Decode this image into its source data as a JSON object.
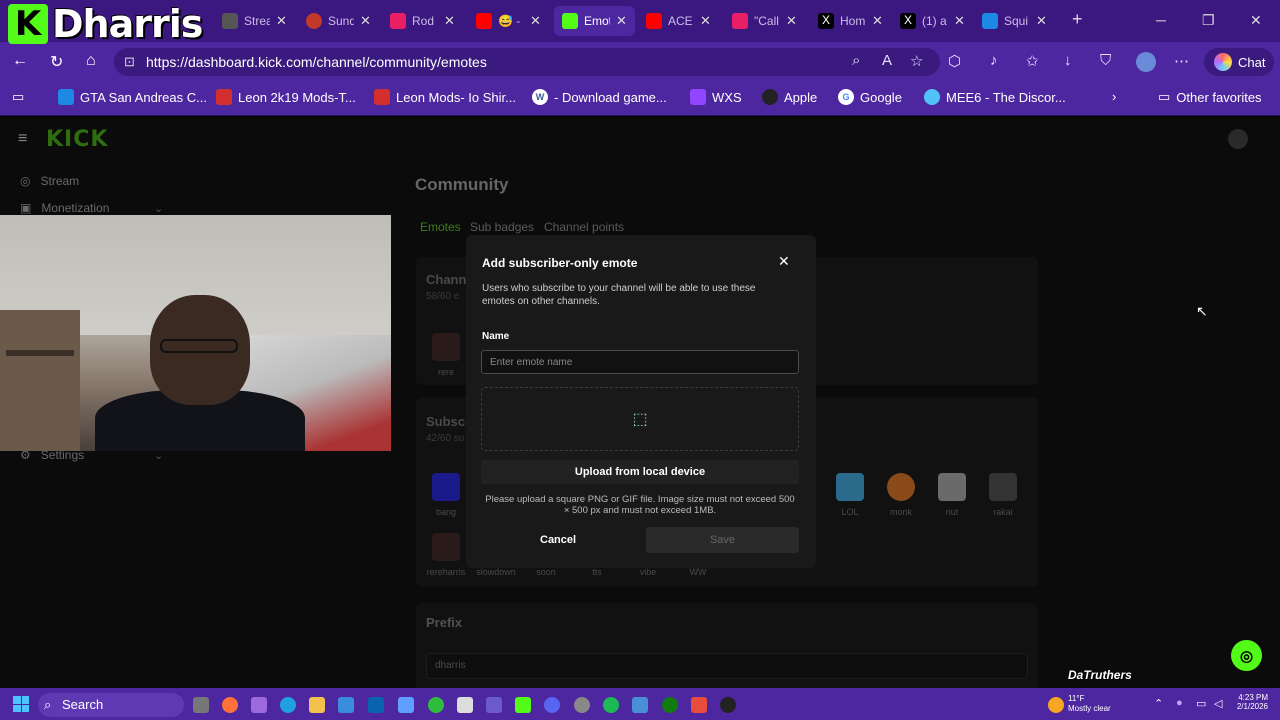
{
  "overlay_logo": {
    "letter": "K",
    "text": "Dharris"
  },
  "tabs": [
    {
      "label": "Strea",
      "color": "#555"
    },
    {
      "label": "Sund",
      "color": "#c0392b"
    },
    {
      "label": "Rod",
      "color": "#e91e63"
    },
    {
      "label": "😅 -",
      "color": "#ff0000"
    },
    {
      "label": "Emot",
      "color": "#53fc18",
      "active": true
    },
    {
      "label": "ACE",
      "color": "#ff0000"
    },
    {
      "label": "\"Call",
      "color": "#e91e63"
    },
    {
      "label": "Hom",
      "color": "#000000"
    },
    {
      "label": "(1) a",
      "color": "#000000"
    },
    {
      "label": "Squi",
      "color": "#1e88e5"
    }
  ],
  "window_buttons": {
    "new_tab": "+",
    "minimize": "─",
    "restore": "❐",
    "close": "✕"
  },
  "address": {
    "url": "https://dashboard.kick.com/channel/community/emotes",
    "chat_label": "Chat"
  },
  "bookmarks": [
    {
      "label": "GTA San Andreas C...",
      "color": "#1e88e5",
      "glyph": "GPH"
    },
    {
      "label": "Leon 2k19 Mods-T...",
      "color": "#d32f2f",
      "glyph": "L"
    },
    {
      "label": "Leon Mods- Io Shir...",
      "color": "#d32f2f",
      "glyph": "L"
    },
    {
      "label": "- Download game...",
      "color": "#3b5998",
      "glyph": "W"
    },
    {
      "label": "WXS",
      "color": "#9146ff",
      "glyph": "T"
    },
    {
      "label": "Apple",
      "color": "#222222",
      "glyph": "A"
    },
    {
      "label": "Google",
      "color": "#ffffff",
      "glyph": "G"
    },
    {
      "label": "MEE6 - The Discor...",
      "color": "#4fc3f7",
      "glyph": "M"
    }
  ],
  "other_favorites": "Other favorites",
  "sidebar": {
    "items": [
      {
        "label": "Stream"
      },
      {
        "label": "Monetization"
      },
      {
        "label": "Settings"
      }
    ]
  },
  "page": {
    "title": "Community",
    "tabs": [
      "Emotes",
      "Sub badges",
      "Channel points"
    ],
    "channel_card": {
      "title": "Chann",
      "sub": "58/60 e",
      "emote": "rere"
    },
    "sub_card": {
      "title": "Subscr",
      "sub": "42/60 su"
    },
    "sub_emotes_row1": [
      {
        "name": "bang",
        "color": "#1a1a8a"
      },
      {
        "name": "LOL",
        "color": "#2a6a8a"
      },
      {
        "name": "monk",
        "color": "#8a4a1a"
      },
      {
        "name": "nut",
        "color": "#bbbbbb"
      },
      {
        "name": "rakai",
        "color": "#555555"
      }
    ],
    "sub_emotes_row2": [
      {
        "name": "rereharris",
        "color": "#3a3a3a"
      },
      {
        "name": "slowdown",
        "color": "#111111"
      },
      {
        "name": "soon",
        "color": "#111111"
      },
      {
        "name": "tts",
        "color": "#111111"
      },
      {
        "name": "vibe",
        "color": "#111111"
      },
      {
        "name": "WW",
        "color": "#111111"
      }
    ],
    "prefix_label": "Prefix",
    "prefix_value": "dharris"
  },
  "modal": {
    "title": "Add subscriber-only emote",
    "description": "Users who subscribe to your channel will be able to use these emotes on other channels.",
    "name_label": "Name",
    "name_placeholder": "Enter emote name",
    "upload_label": "Upload from local device",
    "hint": "Please upload a square PNG or GIF file. Image size must not exceed 500 × 500 px and must not exceed 1MB.",
    "cancel_label": "Cancel",
    "save_label": "Save"
  },
  "taskbar": {
    "search_label": "Search",
    "weather_temp": "11°F",
    "weather_desc": "Mostly clear",
    "time": "4:23 PM",
    "date": "2/1/2026",
    "badge": "DaTruthers"
  },
  "colors": {
    "kick_green": "#53fc18",
    "browser_purple": "#4d27a0",
    "tab_strip": "#3b1780"
  }
}
